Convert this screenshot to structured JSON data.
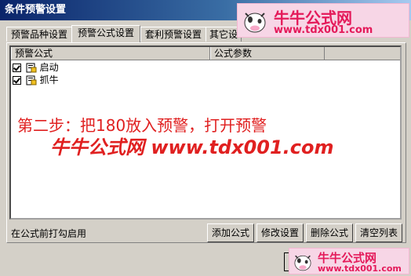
{
  "window": {
    "title": "条件预警设置"
  },
  "tabs": [
    {
      "label": "预警品种设置",
      "active": false
    },
    {
      "label": "预警公式设置",
      "active": true
    },
    {
      "label": "套利预警设置",
      "active": false
    },
    {
      "label": "其它设",
      "active": false
    }
  ],
  "list": {
    "columns": [
      "预警公式",
      "公式参数"
    ],
    "rows": [
      {
        "name": "启动",
        "params": "",
        "checked": true
      },
      {
        "name": "抓牛",
        "params": "",
        "checked": true
      }
    ]
  },
  "overlay": {
    "step_text": "第二步：把180放入预警，打开预警",
    "watermark": "牛牛公式网 www.tdx001.com"
  },
  "hint": "在公式前打勾启用",
  "buttons": {
    "add": "添加公式",
    "modify": "修改设置",
    "delete": "删除公式",
    "clear": "清空列表"
  },
  "logo": {
    "brand": "牛牛公式网",
    "url": "www.tdx001.com"
  },
  "colors": {
    "accent": "#e41a5a",
    "overlay": "#e02020",
    "title": "#0a246a"
  }
}
